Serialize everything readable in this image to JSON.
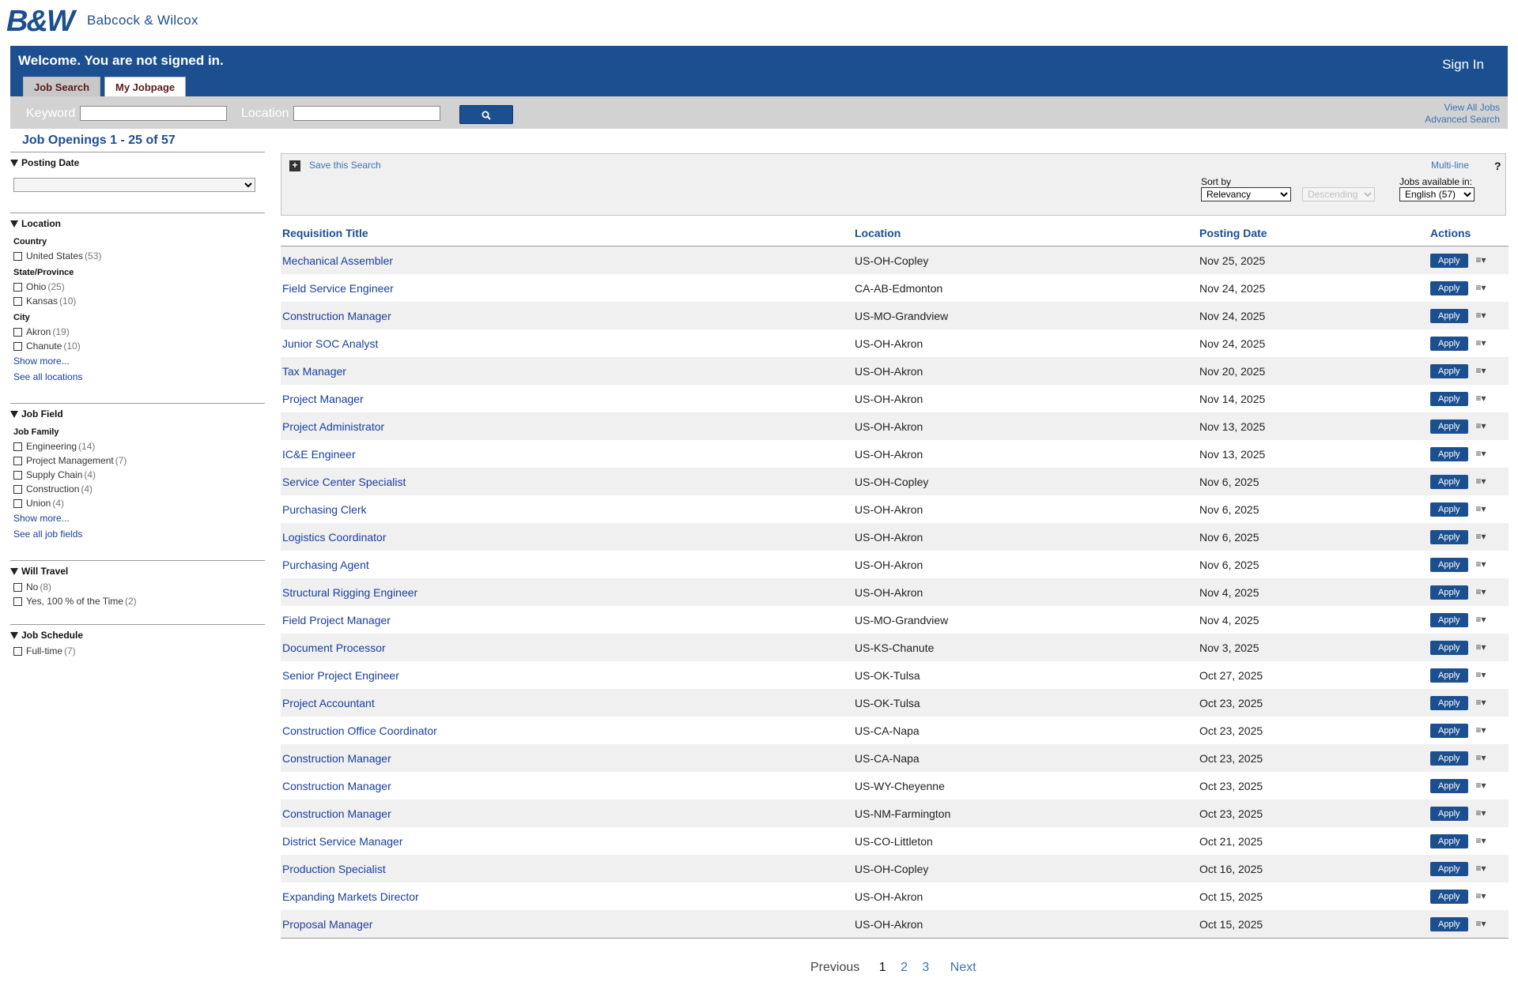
{
  "brand": {
    "mark": "B&W",
    "name": "Babcock & Wilcox"
  },
  "header": {
    "welcome": "Welcome. You are not signed in.",
    "signin": "Sign In",
    "tabs": [
      {
        "label": "Job Search"
      },
      {
        "label": "My Jobpage"
      }
    ]
  },
  "search": {
    "keyword_label": "Keyword",
    "location_label": "Location",
    "view_all": "View All Jobs",
    "advanced": "Advanced Search",
    "button_icon": "search-icon"
  },
  "results_heading": "Job Openings 1 - 25 of 57",
  "sidebar": {
    "posting_date": {
      "title": "Posting Date"
    },
    "location": {
      "title": "Location",
      "country": {
        "label": "Country",
        "options": [
          {
            "name": "United States",
            "count": "(53)"
          }
        ]
      },
      "state": {
        "label": "State/Province",
        "options": [
          {
            "name": "Ohio",
            "count": "(25)"
          },
          {
            "name": "Kansas",
            "count": "(10)"
          }
        ]
      },
      "city": {
        "label": "City",
        "options": [
          {
            "name": "Akron",
            "count": "(19)"
          },
          {
            "name": "Chanute",
            "count": "(10)"
          }
        ]
      },
      "show_more": "Show more...",
      "see_all": "See all locations"
    },
    "job_field": {
      "title": "Job Field",
      "family_label": "Job Family",
      "options": [
        {
          "name": "Engineering",
          "count": "(14)"
        },
        {
          "name": "Project Management",
          "count": "(7)"
        },
        {
          "name": "Supply Chain",
          "count": "(4)"
        },
        {
          "name": "Construction",
          "count": "(4)"
        },
        {
          "name": "Union",
          "count": "(4)"
        }
      ],
      "show_more": "Show more...",
      "see_all": "See all job fields"
    },
    "will_travel": {
      "title": "Will Travel",
      "options": [
        {
          "name": "No",
          "count": "(8)"
        },
        {
          "name": "Yes, 100 % of the Time",
          "count": "(2)"
        }
      ]
    },
    "job_schedule": {
      "title": "Job Schedule",
      "options": [
        {
          "name": "Full-time",
          "count": "(7)"
        }
      ]
    }
  },
  "toolbox": {
    "save_search": "Save this Search",
    "multiline": "Multi-line",
    "help": "?",
    "sort_by_label": "Sort by",
    "sort_by_value": "Relevancy",
    "order_value": "Descending",
    "jobs_available_label": "Jobs available in:",
    "language_value": "English (57)"
  },
  "table": {
    "headers": {
      "title": "Requisition Title",
      "location": "Location",
      "date": "Posting Date",
      "actions": "Actions"
    },
    "apply_label": "Apply",
    "rows": [
      {
        "title": "Mechanical Assembler",
        "location": "US-OH-Copley",
        "date": "Nov 25, 2025"
      },
      {
        "title": "Field Service Engineer",
        "location": "CA-AB-Edmonton",
        "date": "Nov 24, 2025"
      },
      {
        "title": "Construction Manager",
        "location": "US-MO-Grandview",
        "date": "Nov 24, 2025"
      },
      {
        "title": "Junior SOC Analyst",
        "location": "US-OH-Akron",
        "date": "Nov 24, 2025"
      },
      {
        "title": "Tax Manager",
        "location": "US-OH-Akron",
        "date": "Nov 20, 2025"
      },
      {
        "title": "Project Manager",
        "location": "US-OH-Akron",
        "date": "Nov 14, 2025"
      },
      {
        "title": "Project Administrator",
        "location": "US-OH-Akron",
        "date": "Nov 13, 2025"
      },
      {
        "title": "IC&E Engineer",
        "location": "US-OH-Akron",
        "date": "Nov 13, 2025"
      },
      {
        "title": "Service Center Specialist",
        "location": "US-OH-Copley",
        "date": "Nov 6, 2025"
      },
      {
        "title": "Purchasing Clerk",
        "location": "US-OH-Akron",
        "date": "Nov 6, 2025"
      },
      {
        "title": "Logistics Coordinator",
        "location": "US-OH-Akron",
        "date": "Nov 6, 2025"
      },
      {
        "title": "Purchasing Agent",
        "location": "US-OH-Akron",
        "date": "Nov 6, 2025"
      },
      {
        "title": "Structural Rigging Engineer",
        "location": "US-OH-Akron",
        "date": "Nov 4, 2025"
      },
      {
        "title": "Field Project Manager",
        "location": "US-MO-Grandview",
        "date": "Nov 4, 2025"
      },
      {
        "title": "Document Processor",
        "location": "US-KS-Chanute",
        "date": "Nov 3, 2025"
      },
      {
        "title": "Senior Project Engineer",
        "location": "US-OK-Tulsa",
        "date": "Oct 27, 2025"
      },
      {
        "title": "Project Accountant",
        "location": "US-OK-Tulsa",
        "date": "Oct 23, 2025"
      },
      {
        "title": "Construction Office Coordinator",
        "location": "US-CA-Napa",
        "date": "Oct 23, 2025"
      },
      {
        "title": "Construction Manager",
        "location": "US-CA-Napa",
        "date": "Oct 23, 2025"
      },
      {
        "title": "Construction Manager",
        "location": "US-WY-Cheyenne",
        "date": "Oct 23, 2025"
      },
      {
        "title": "Construction Manager",
        "location": "US-NM-Farmington",
        "date": "Oct 23, 2025"
      },
      {
        "title": "District Service Manager",
        "location": "US-CO-Littleton",
        "date": "Oct 21, 2025"
      },
      {
        "title": "Production Specialist",
        "location": "US-OH-Copley",
        "date": "Oct 16, 2025"
      },
      {
        "title": "Expanding Markets Director",
        "location": "US-OH-Akron",
        "date": "Oct 15, 2025"
      },
      {
        "title": "Proposal Manager",
        "location": "US-OH-Akron",
        "date": "Oct 15, 2025"
      }
    ]
  },
  "pagination": {
    "previous": "Previous",
    "current": "1",
    "pages": [
      "2",
      "3"
    ],
    "next": "Next"
  },
  "colors": {
    "brand_blue": "#1c4f8f",
    "link_blue": "#1a3ea0",
    "row_alt": "#f0f0f0"
  }
}
